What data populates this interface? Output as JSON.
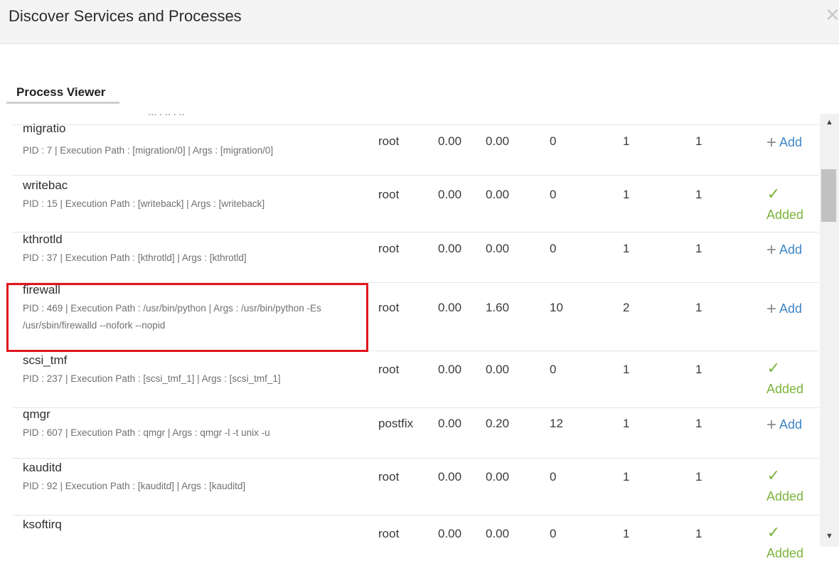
{
  "dialog": {
    "title": "Discover Services and Processes",
    "close_glyph": "✕"
  },
  "tab": {
    "label": "Process Viewer"
  },
  "cut_row_text": "‧‧‧ ‧ ‧‧ ‧ ‧‧",
  "actions": {
    "add_label": "Add",
    "added_label": "Added",
    "plus_glyph": "+",
    "check_glyph": "✓"
  },
  "rows": [
    {
      "name": "migratio",
      "desc": "PID : 7 | Execution Path : [migration/0] | Args : [migration/0]",
      "user": "root",
      "cpu": "0.00",
      "mem": "0.00",
      "col_a": "0",
      "col_b": "1",
      "col_c": "1",
      "status": "add"
    },
    {
      "name": "writebac",
      "desc": "PID : 15 | Execution Path : [writeback] | Args : [writeback]",
      "user": "root",
      "cpu": "0.00",
      "mem": "0.00",
      "col_a": "0",
      "col_b": "1",
      "col_c": "1",
      "status": "added"
    },
    {
      "name": "kthrotld",
      "desc": "PID : 37 | Execution Path : [kthrotld] | Args : [kthrotld]",
      "user": "root",
      "cpu": "0.00",
      "mem": "0.00",
      "col_a": "0",
      "col_b": "1",
      "col_c": "1",
      "status": "add"
    },
    {
      "name": "firewall",
      "desc": "PID : 469 | Execution Path : /usr/bin/python | Args : /usr/bin/python -Es /usr/sbin/firewalld --nofork --nopid",
      "user": "root",
      "cpu": "0.00",
      "mem": "1.60",
      "col_a": "10",
      "col_b": "2",
      "col_c": "1",
      "status": "add"
    },
    {
      "name": "scsi_tmf",
      "desc": "PID : 237 | Execution Path : [scsi_tmf_1] | Args : [scsi_tmf_1]",
      "user": "root",
      "cpu": "0.00",
      "mem": "0.00",
      "col_a": "0",
      "col_b": "1",
      "col_c": "1",
      "status": "added"
    },
    {
      "name": "qmgr",
      "desc": "PID : 607 | Execution Path : qmgr | Args : qmgr -l -t unix -u",
      "user": "postfix",
      "cpu": "0.00",
      "mem": "0.20",
      "col_a": "12",
      "col_b": "1",
      "col_c": "1",
      "status": "add"
    },
    {
      "name": "kauditd",
      "desc": "PID : 92 | Execution Path : [kauditd] | Args : [kauditd]",
      "user": "root",
      "cpu": "0.00",
      "mem": "0.00",
      "col_a": "0",
      "col_b": "1",
      "col_c": "1",
      "status": "added"
    },
    {
      "name": "ksoftirq",
      "desc": "",
      "user": "root",
      "cpu": "0.00",
      "mem": "0.00",
      "col_a": "0",
      "col_b": "1",
      "col_c": "1",
      "status": "added"
    }
  ],
  "scrollbar": {
    "up_glyph": "▲",
    "down_glyph": "▼"
  },
  "colors": {
    "add_blue": "#3f86c7",
    "added_green": "#7db43c",
    "highlight_red": "#e0141e"
  }
}
